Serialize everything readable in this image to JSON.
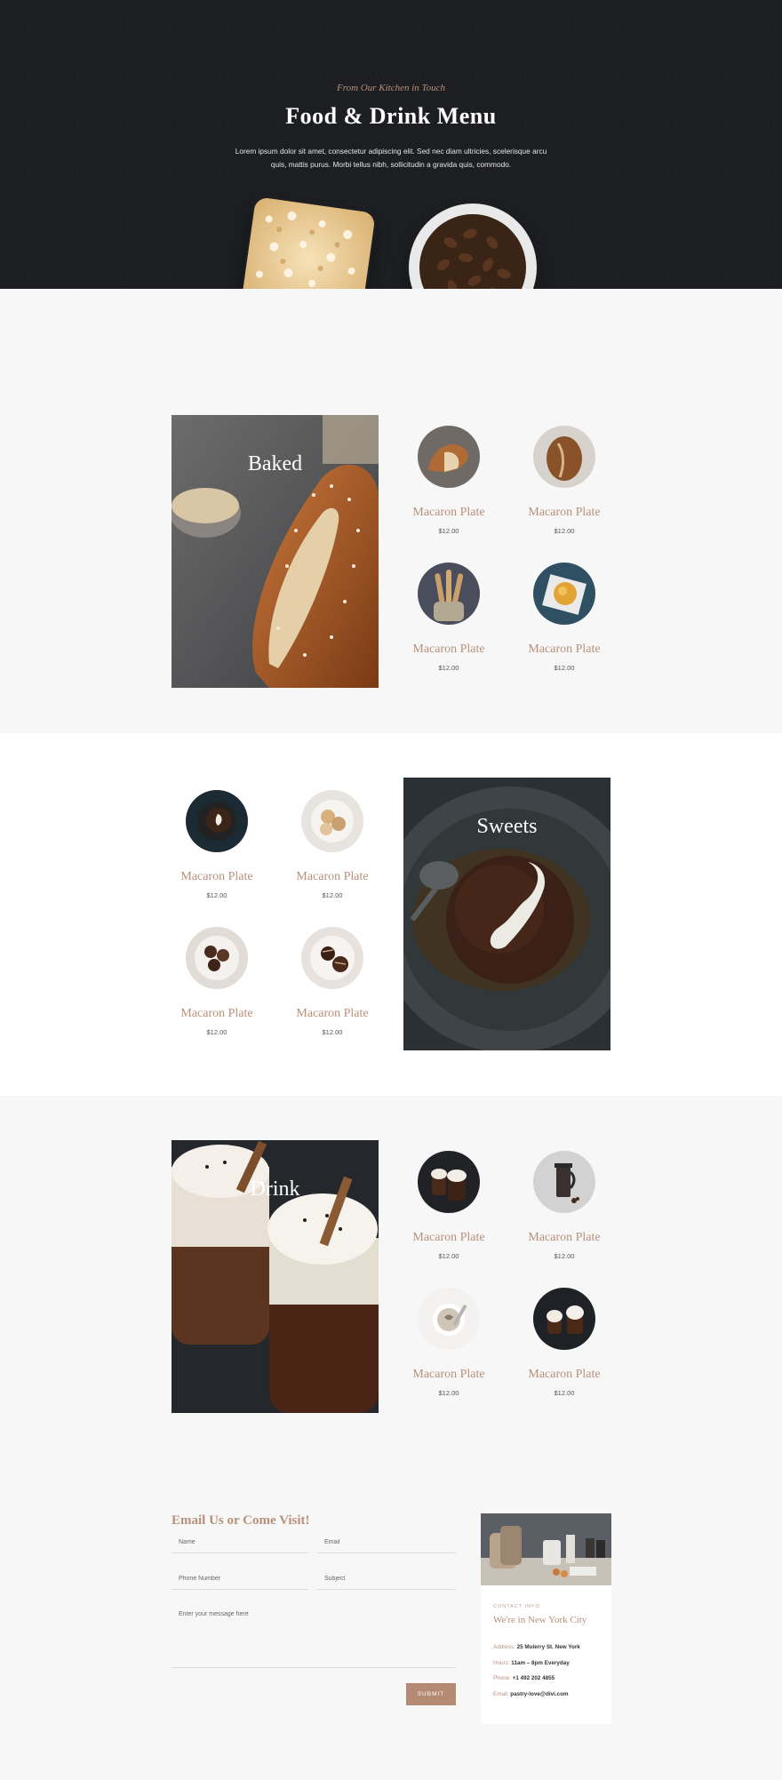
{
  "hero": {
    "tagline": "From Our Kitchen in Touch",
    "title": "Food & Drink Menu",
    "description": "Lorem ipsum dolor sit amet, consectetur adipiscing elit. Sed nec diam ultricies, scelerisque arcu quis, mattis purus. Morbi tellus nibh, sollicitudin a gravida quis, commodo."
  },
  "sections": {
    "baked": {
      "title": "Baked",
      "items": [
        {
          "name": "Macaron Plate",
          "price": "$12.00"
        },
        {
          "name": "Macaron Plate",
          "price": "$12.00"
        },
        {
          "name": "Macaron Plate",
          "price": "$12.00"
        },
        {
          "name": "Macaron Plate",
          "price": "$12.00"
        }
      ]
    },
    "sweets": {
      "title": "Sweets",
      "items": [
        {
          "name": "Macaron Plate",
          "price": "$12.00"
        },
        {
          "name": "Macaron Plate",
          "price": "$12.00"
        },
        {
          "name": "Macaron Plate",
          "price": "$12.00"
        },
        {
          "name": "Macaron Plate",
          "price": "$12.00"
        }
      ]
    },
    "drink": {
      "title": "Drink",
      "items": [
        {
          "name": "Macaron Plate",
          "price": "$12.00"
        },
        {
          "name": "Macaron Plate",
          "price": "$12.00"
        },
        {
          "name": "Macaron Plate",
          "price": "$12.00"
        },
        {
          "name": "Macaron Plate",
          "price": "$12.00"
        }
      ]
    }
  },
  "contact": {
    "heading": "Email Us or Come Visit!",
    "name_placeholder": "Name",
    "email_placeholder": "Email",
    "phone_placeholder": "Phone Number",
    "subject_placeholder": "Subject",
    "message_placeholder": "Enter your message here",
    "submit_label": "SUBMIT"
  },
  "info": {
    "label": "CONTACT INFO",
    "city": "We're in New York City",
    "address_key": "Address:",
    "address": "25 Mulerry St. New York",
    "hours_key": "Hours:",
    "hours": "11am – 8pm Everyday",
    "phone_key": "Phone:",
    "phone": "+1 492 202 4855",
    "email_key": "Email:",
    "email": "pastry-love@divi.com"
  },
  "colors": {
    "accent": "#b9907a",
    "hero_bg": "#1c1e22",
    "button": "#b58a74"
  }
}
